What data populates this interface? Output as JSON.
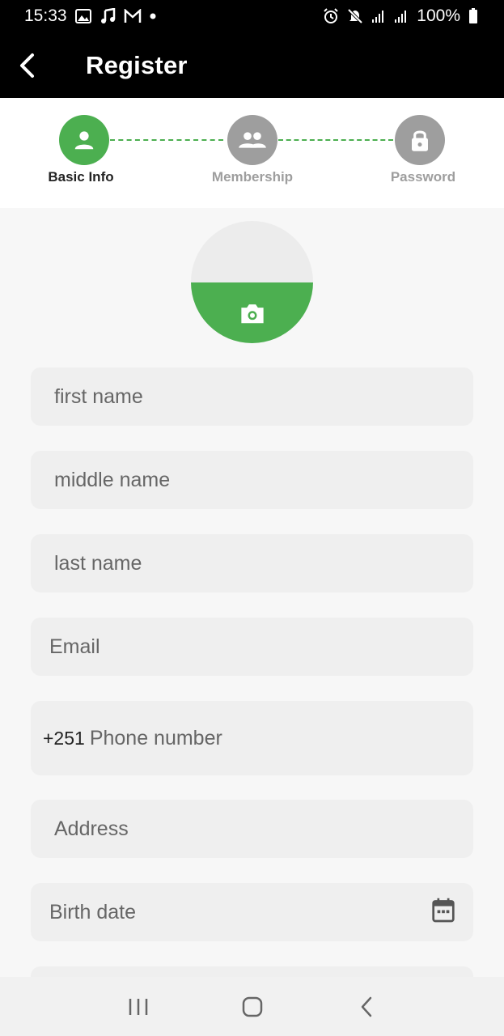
{
  "status_bar": {
    "time": "15:33",
    "battery": "100%",
    "left_icons": [
      "gallery-icon",
      "music-icon",
      "gmail-icon",
      "dot-icon"
    ],
    "right_icons": [
      "alarm-icon",
      "mute-icon",
      "signal-icon",
      "signal-icon",
      "battery-icon"
    ]
  },
  "app_bar": {
    "title": "Register"
  },
  "stepper": {
    "steps": [
      {
        "label": "Basic Info",
        "icon": "person-icon",
        "state": "active"
      },
      {
        "label": "Membership",
        "icon": "group-icon",
        "state": "inactive"
      },
      {
        "label": "Password",
        "icon": "lock-icon",
        "state": "inactive"
      }
    ]
  },
  "form": {
    "first_name": {
      "placeholder": "first name",
      "value": ""
    },
    "middle_name": {
      "placeholder": "middle name",
      "value": ""
    },
    "last_name": {
      "placeholder": "last name",
      "value": ""
    },
    "email": {
      "placeholder": "Email",
      "value": ""
    },
    "phone": {
      "prefix": "+251",
      "placeholder": "Phone number",
      "value": ""
    },
    "address": {
      "placeholder": "Address",
      "value": ""
    },
    "birth_date": {
      "placeholder": "Birth date",
      "value": ""
    }
  },
  "colors": {
    "accent": "#4caf50",
    "inactive": "#9e9e9e",
    "app_bar": "#000000",
    "field_bg": "#efefef"
  }
}
